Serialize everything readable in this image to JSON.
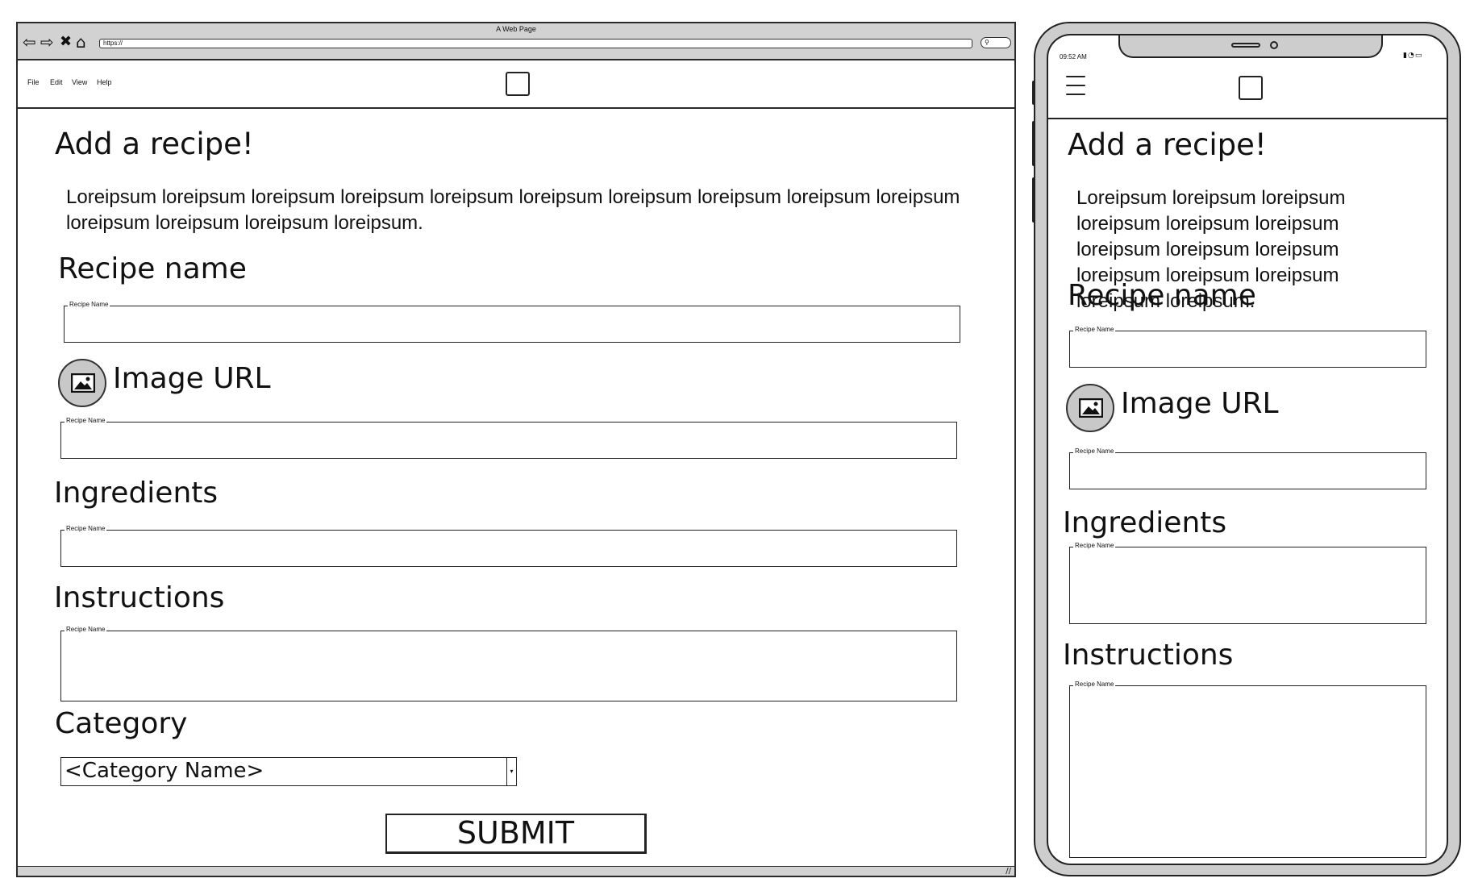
{
  "browser": {
    "window_title": "A Web Page",
    "url": "https://",
    "nav_icons": [
      "back-arrow-icon",
      "forward-arrow-icon",
      "close-x-icon",
      "home-icon"
    ],
    "menu": [
      "File",
      "Edit",
      "View",
      "Help"
    ],
    "grip": "//"
  },
  "form": {
    "title": "Add a recipe!",
    "intro": "Loreipsum loreipsum loreipsum loreipsum loreipsum loreipsum loreipsum loreipsum loreipsum loreipsum loreipsum loreipsum loreipsum loreipsum.",
    "recipe_name_heading": "Recipe name",
    "image_url_heading": "Image URL",
    "ingredients_heading": "Ingredients",
    "instructions_heading": "Instructions",
    "category_heading": "Category",
    "field_label": "Recipe Name",
    "category_value": "<Category Name>",
    "submit_label": "SUBMIT"
  },
  "phone": {
    "time": "09:52 AM",
    "status_icons": [
      "signal-icon",
      "wifi-icon",
      "battery-icon"
    ]
  }
}
